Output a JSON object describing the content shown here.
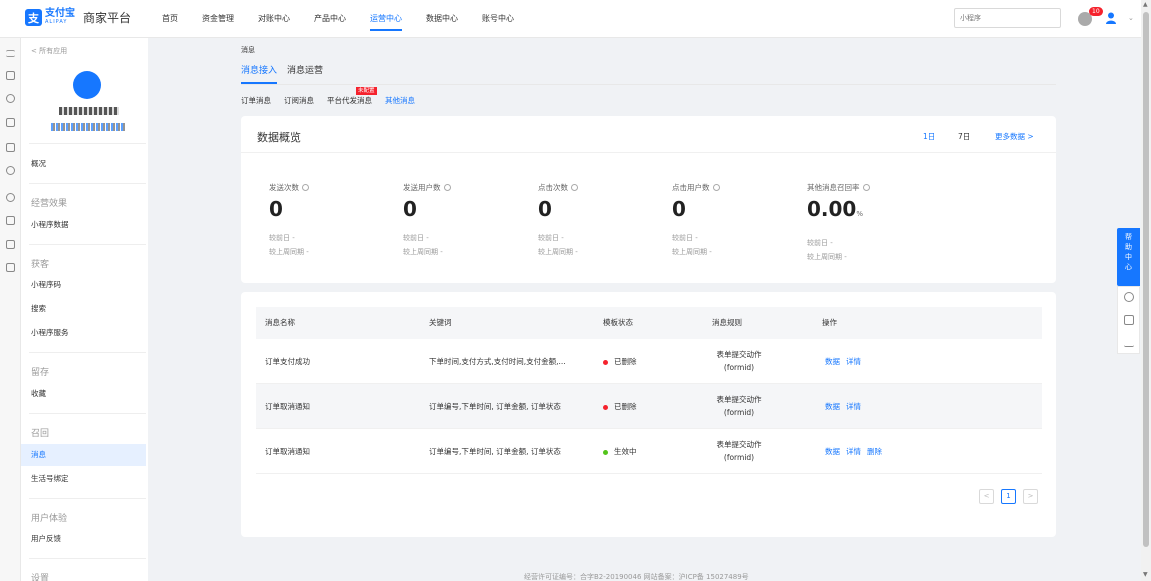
{
  "header": {
    "logo_cn": "支付宝",
    "logo_en": "ALIPAY",
    "platform": "商家平台",
    "nav": [
      {
        "label": "首页"
      },
      {
        "label": "资金管理"
      },
      {
        "label": "对账中心"
      },
      {
        "label": "产品中心"
      },
      {
        "label": "运营中心",
        "active": true
      },
      {
        "label": "数据中心"
      },
      {
        "label": "账号中心"
      }
    ],
    "search_placeholder": "小程序",
    "notification_count": "10"
  },
  "sidebar": {
    "back_link": "< 所有应用",
    "overview": "概况",
    "groups": {
      "effect": "经营效果",
      "acquire": "获客",
      "retain": "留存",
      "recall": "召回",
      "experience": "用户体验",
      "settings": "设置"
    },
    "items": {
      "mini_data": "小程序数据",
      "mini_code": "小程序码",
      "search": "搜索",
      "mini_service": "小程序服务",
      "favorite": "收藏",
      "message": "消息",
      "life_bind": "生活号绑定",
      "feedback": "用户反馈"
    }
  },
  "breadcrumb": "消息",
  "tabs": [
    {
      "label": "消息接入",
      "active": true
    },
    {
      "label": "消息运营"
    }
  ],
  "subtabs": [
    {
      "label": "订单消息"
    },
    {
      "label": "订阅消息"
    },
    {
      "label": "平台代发消息",
      "badge": "未配置"
    },
    {
      "label": "其他消息",
      "active": true
    }
  ],
  "overview_card": {
    "title": "数据概览",
    "ranges": [
      "1日",
      "7日"
    ],
    "more": "更多数据 >",
    "metrics": [
      {
        "label": "发送次数",
        "value": "0",
        "vs_day": "较前日 -",
        "vs_week": "较上周同期 -"
      },
      {
        "label": "发送用户数",
        "value": "0",
        "vs_day": "较前日 -",
        "vs_week": "较上周同期 -"
      },
      {
        "label": "点击次数",
        "value": "0",
        "vs_day": "较前日 -",
        "vs_week": "较上周同期 -"
      },
      {
        "label": "点击用户数",
        "value": "0",
        "vs_day": "较前日 -",
        "vs_week": "较上周同期 -"
      },
      {
        "label": "其他消息召回率",
        "value": "0.00",
        "unit": "%",
        "vs_day": "较前日 -",
        "vs_week": "较上周同期 -"
      }
    ]
  },
  "table": {
    "headers": [
      "消息名称",
      "关键词",
      "模板状态",
      "消息规则",
      "操作"
    ],
    "rows": [
      {
        "name": "订单支付成功",
        "keywords": "下单时间,支付方式,支付时间,支付金额,...",
        "status": "已删除",
        "status_color": "#f5222d",
        "rule1": "表单提交动作",
        "rule2": "(formid)",
        "ops": [
          "数据",
          "详情"
        ]
      },
      {
        "name": "订单取消通知",
        "keywords": "订单编号,下单时间, 订单金额, 订单状态",
        "status": "已删除",
        "status_color": "#f5222d",
        "rule1": "表单提交动作",
        "rule2": "(formid)",
        "ops": [
          "数据",
          "详情"
        ]
      },
      {
        "name": "订单取消通知",
        "keywords": "订单编号,下单时间, 订单金额, 订单状态",
        "status": "生效中",
        "status_color": "#52c41a",
        "rule1": "表单提交动作",
        "rule2": "(formid)",
        "ops": [
          "数据",
          "详情",
          "删除"
        ]
      }
    ],
    "pager": {
      "prev": "<",
      "current": "1",
      "next": ">"
    }
  },
  "footer": "经营许可证编号：合字B2-20190046 网站备案：沪ICP备 15027489号",
  "help": {
    "label": "帮助中心"
  },
  "colors": {
    "accent": "#1677ff",
    "danger": "#f5222d",
    "success": "#52c41a"
  }
}
